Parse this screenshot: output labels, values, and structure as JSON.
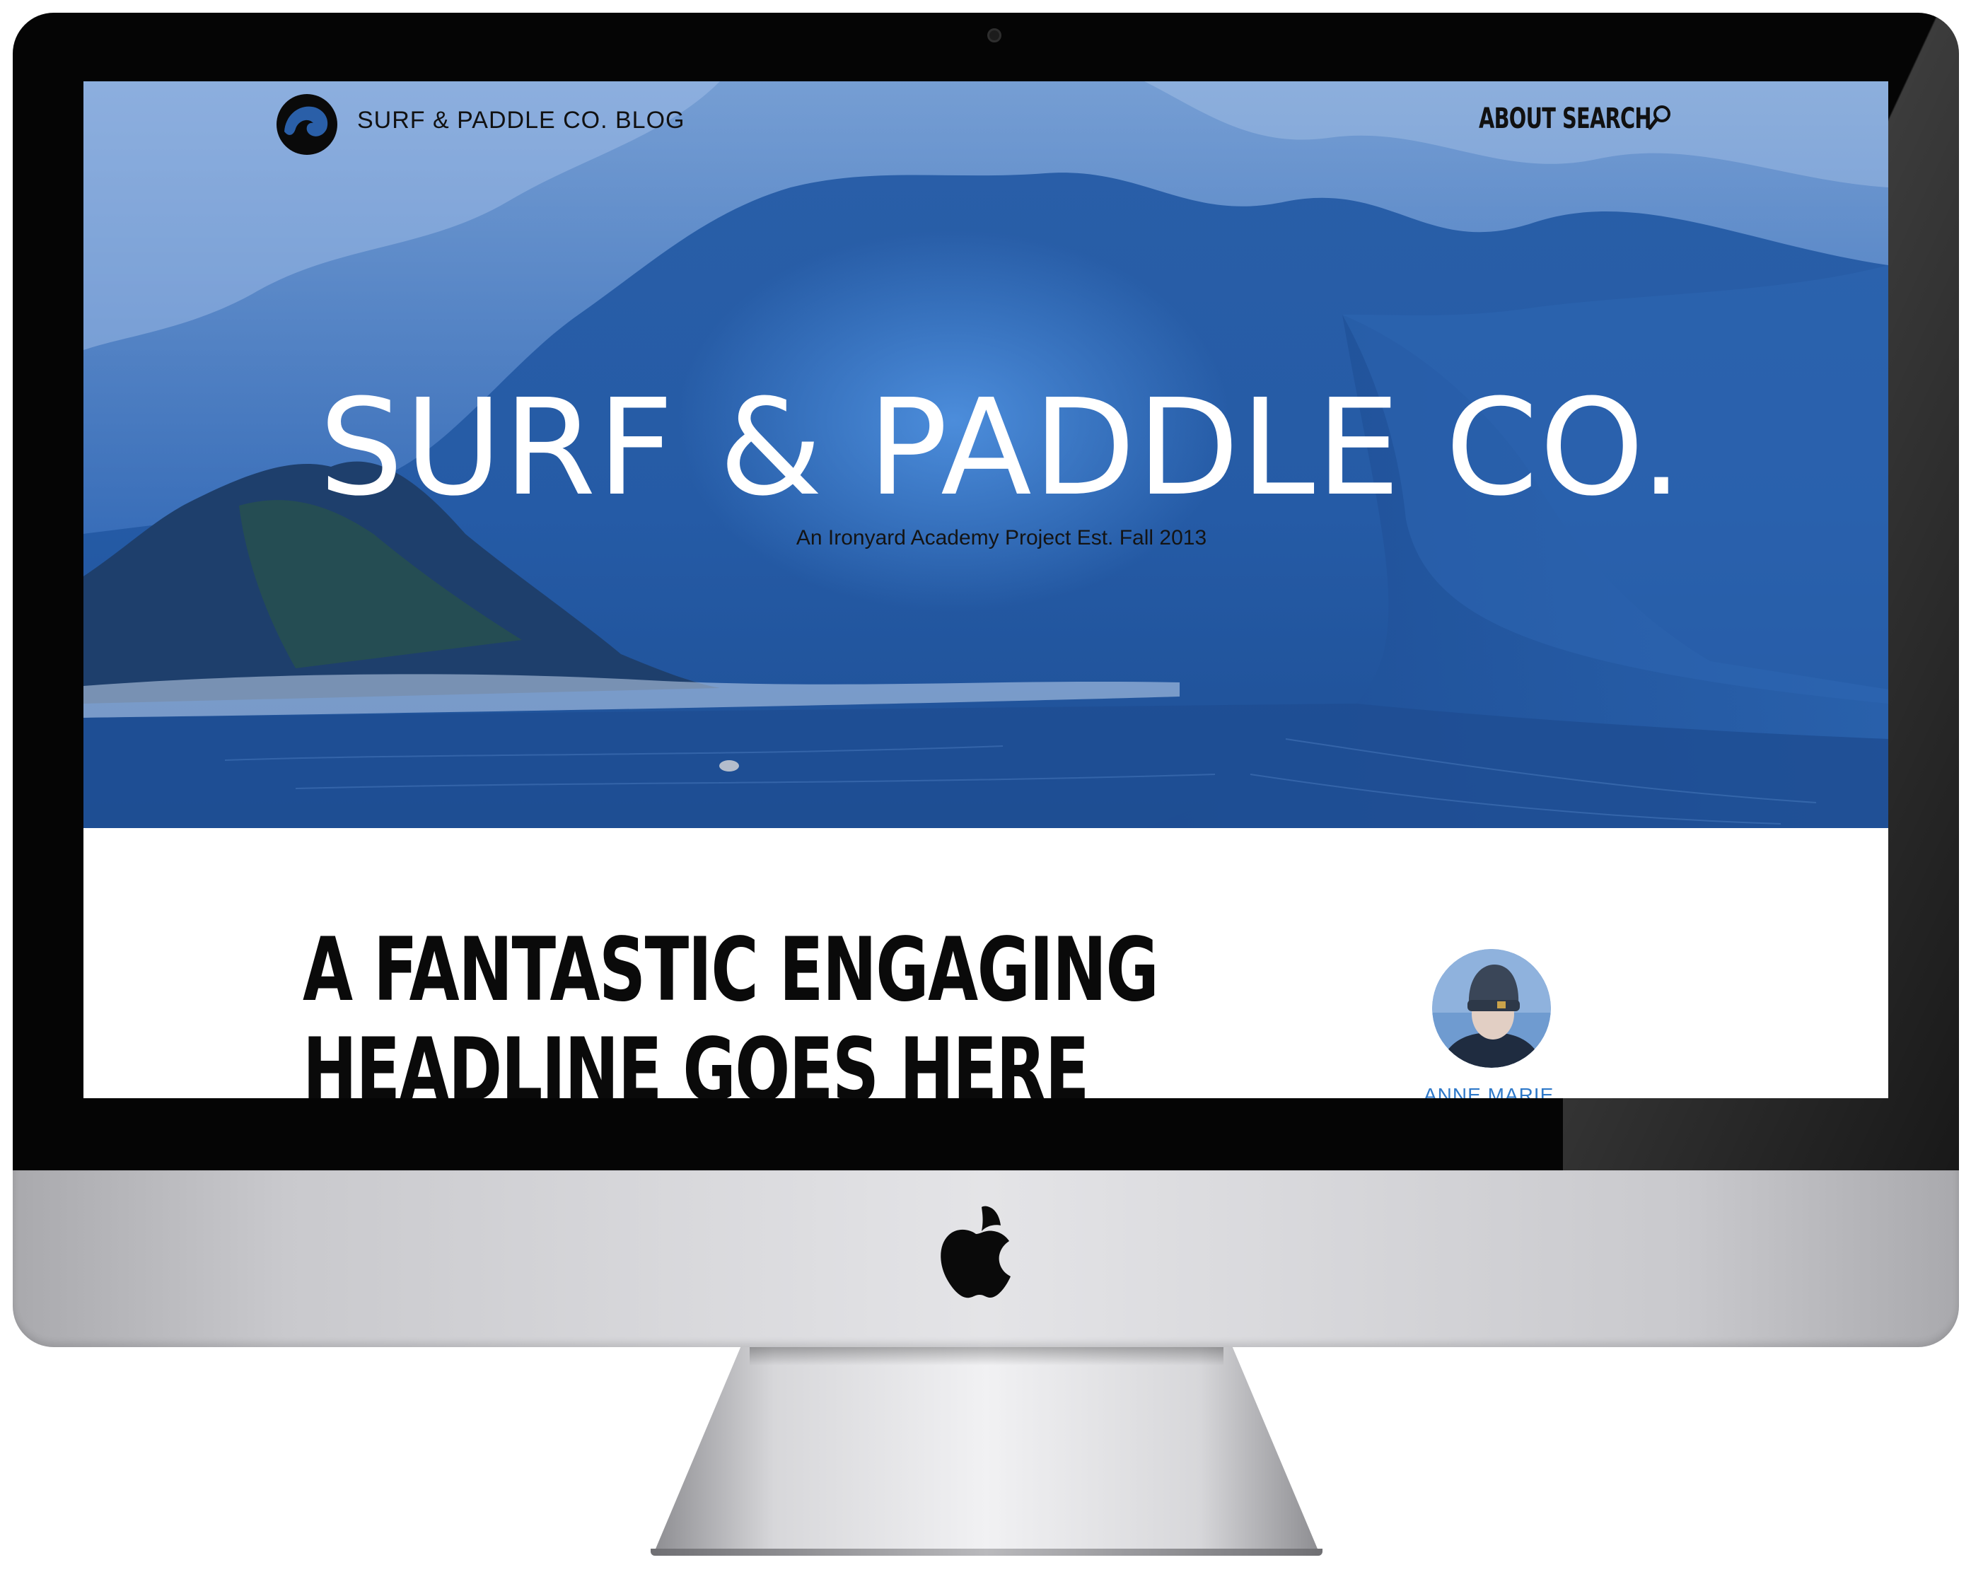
{
  "site": {
    "brand": "SURF & PADDLE CO. BLOG",
    "nav": {
      "about": "ABOUT",
      "search": "SEARCH"
    },
    "icons": {
      "logo": "wave-logo-icon",
      "search": "search-icon",
      "device": "apple-icon"
    }
  },
  "hero": {
    "title": "SURF & PADDLE CO.",
    "tagline": "An Ironyard Academy Project Est. Fall 2013"
  },
  "post": {
    "headline_line1": "A FANTASTIC ENGAGING",
    "headline_line2": "HEADLINE GOES HERE",
    "author": "ANNE MARIE"
  },
  "colors": {
    "hero_overlay": "#2a5fa8",
    "author_link": "#2f79c9",
    "bezel": "#050505"
  }
}
